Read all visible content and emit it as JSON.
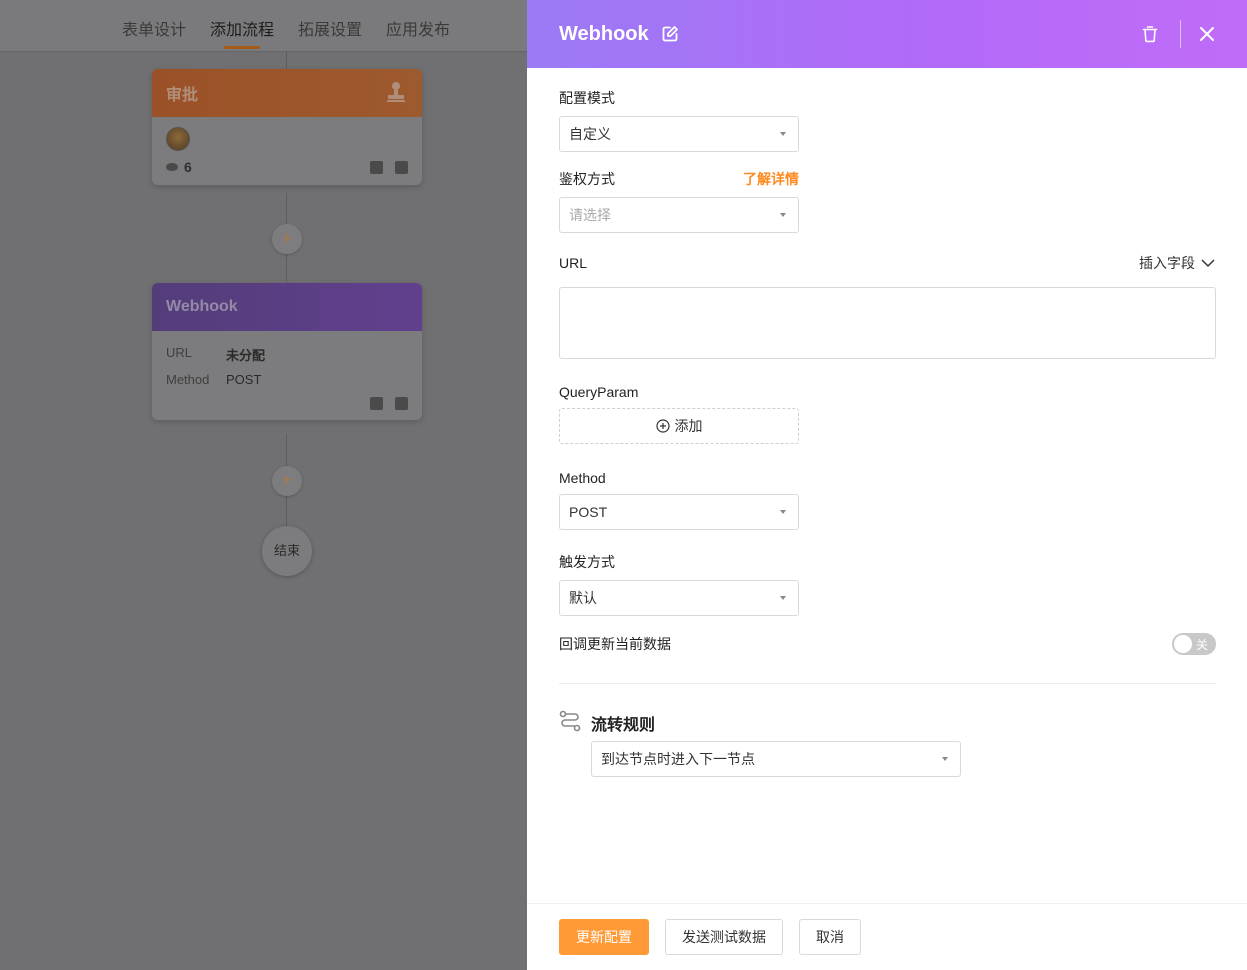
{
  "background": {
    "tabs": [
      {
        "label": "表单设计",
        "active": false
      },
      {
        "label": "添加流程",
        "active": true
      },
      {
        "label": "拓展设置",
        "active": false
      },
      {
        "label": "应用发布",
        "active": false
      }
    ],
    "approval_node": {
      "title": "审批",
      "count": "6"
    },
    "webhook_node": {
      "title": "Webhook",
      "url_label": "URL",
      "url_value": "未分配",
      "method_label": "Method",
      "method_value": "POST"
    },
    "add_symbol": "+",
    "end_label": "结束"
  },
  "drawer": {
    "title": "Webhook",
    "config_mode": {
      "label": "配置模式",
      "value": "自定义"
    },
    "auth": {
      "label": "鉴权方式",
      "link": "了解详情",
      "placeholder": "请选择"
    },
    "url": {
      "label": "URL",
      "insert_label": "插入字段",
      "value": ""
    },
    "query_param": {
      "label": "QueryParam",
      "add_label": "添加"
    },
    "method": {
      "label": "Method",
      "value": "POST"
    },
    "trigger": {
      "label": "触发方式",
      "value": "默认"
    },
    "callback": {
      "label": "回调更新当前数据",
      "toggle_text": "关",
      "enabled": false
    },
    "flow_rule": {
      "title": "流转规则",
      "value": "到达节点时进入下一节点"
    },
    "footer": {
      "update": "更新配置",
      "send_test": "发送测试数据",
      "cancel": "取消"
    },
    "colors": {
      "header_start": "#9b7af5",
      "header_end": "#c06cf8",
      "accent": "#ff9a36",
      "link": "#ff8a1f"
    }
  }
}
